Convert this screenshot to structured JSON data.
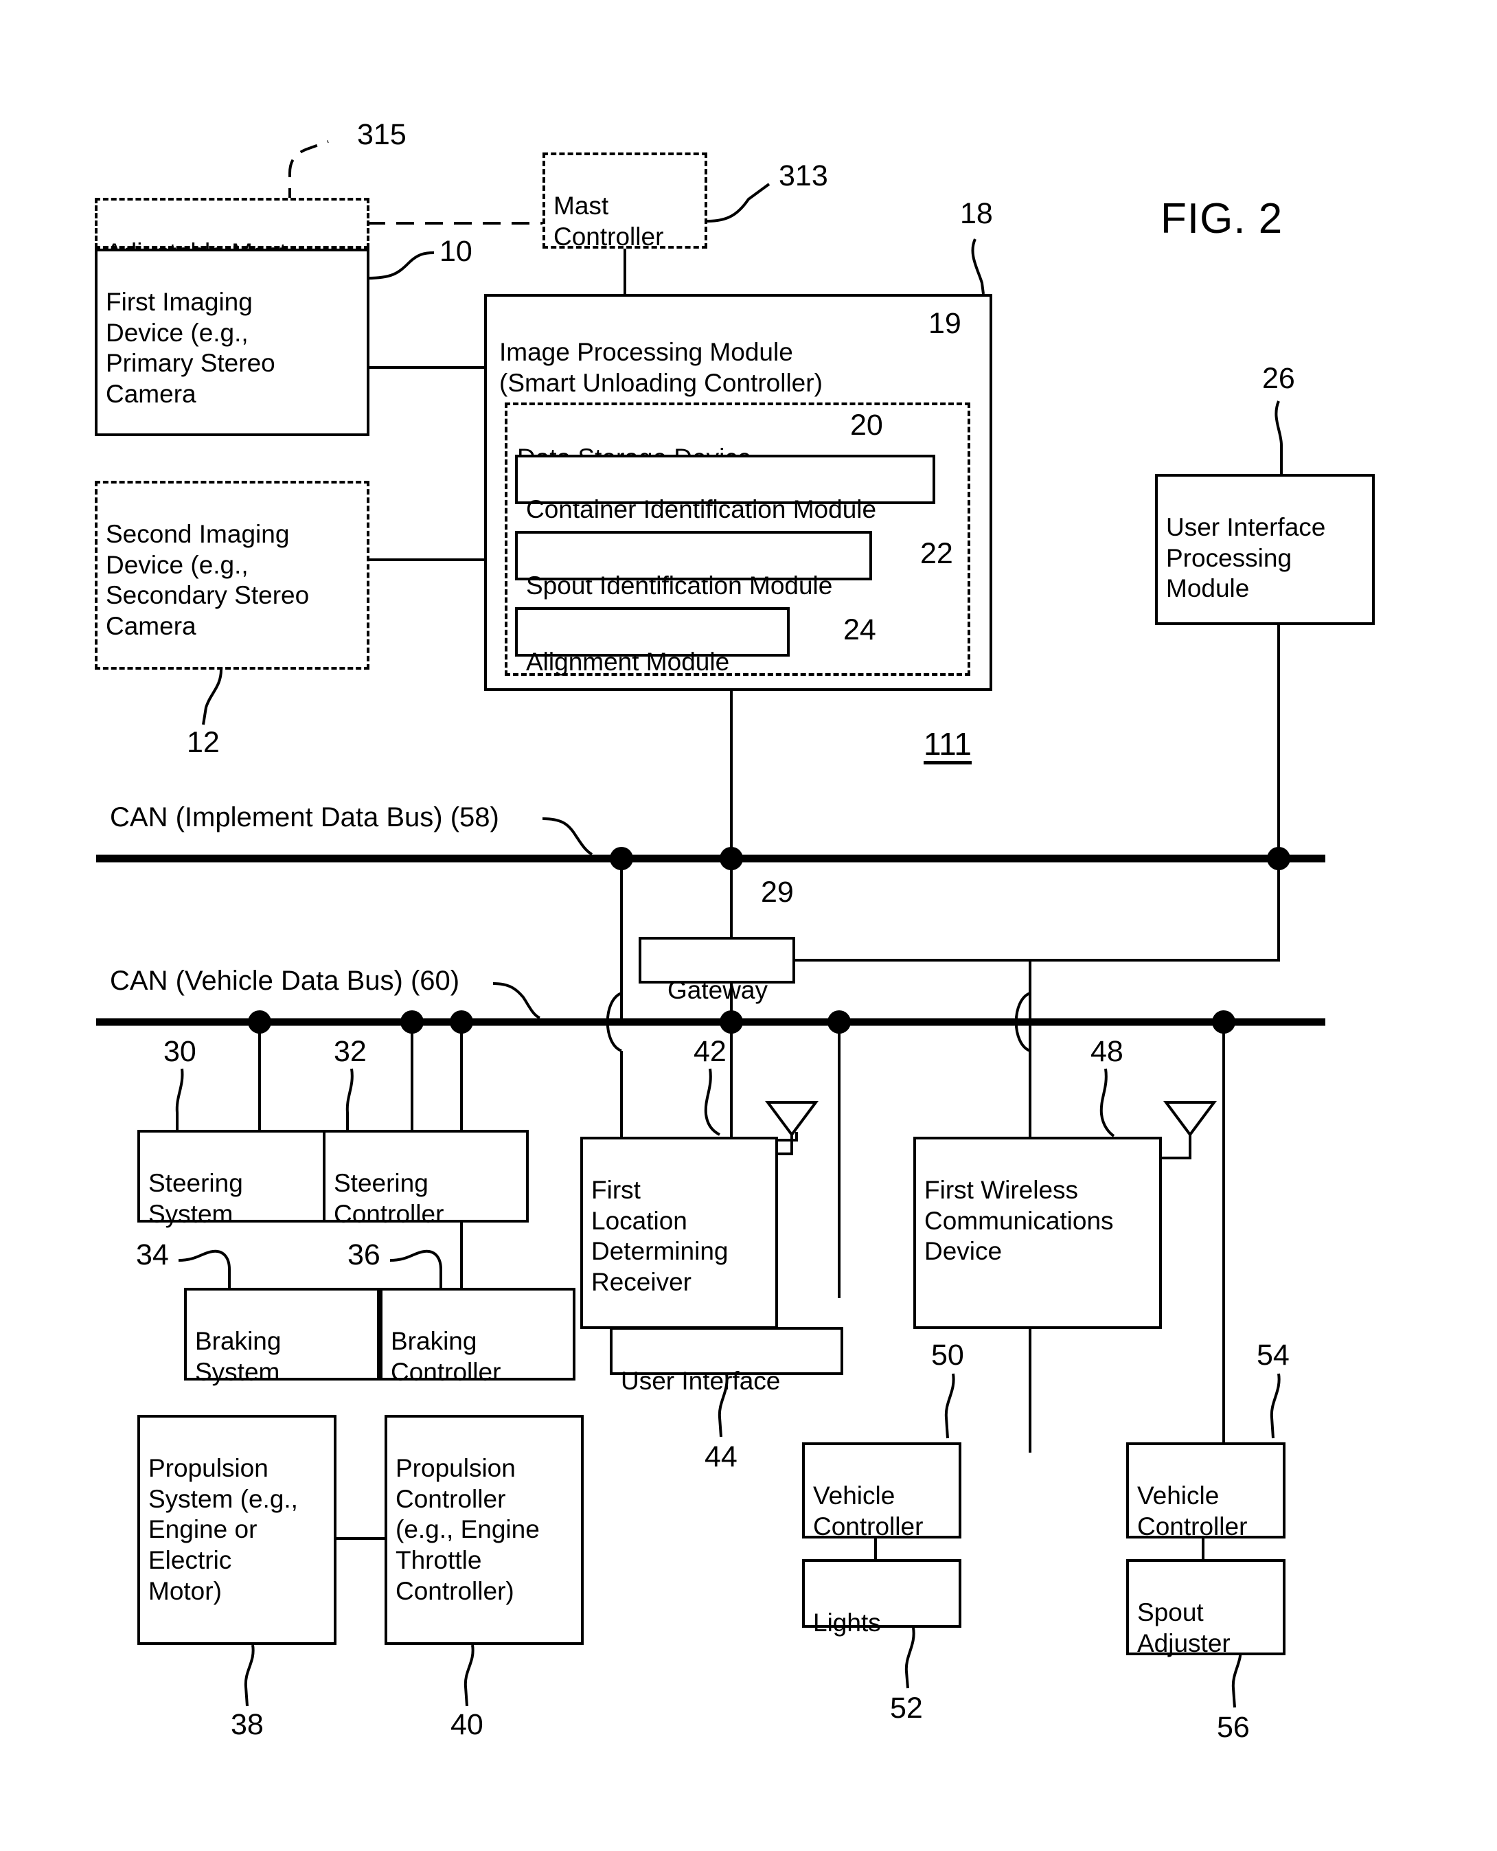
{
  "figure": {
    "label": "FIG. 2",
    "system_ref": "111"
  },
  "blocks": {
    "adjustable_mast": {
      "text": "Adjustable Mast",
      "ref": "315"
    },
    "first_imaging_device": {
      "text": "First Imaging\nDevice (e.g.,\nPrimary Stereo\nCamera",
      "ref": "10"
    },
    "second_imaging_device": {
      "text": "Second Imaging\nDevice (e.g.,\nSecondary Stereo\nCamera",
      "ref": "12"
    },
    "mast_controller": {
      "text": "Mast\nController",
      "ref": "313"
    },
    "image_processing_module": {
      "text": "Image Processing Module\n(Smart Unloading Controller)",
      "ref": "18",
      "inner_ref": "19"
    },
    "data_storage_device": {
      "text": "Data Storage Device",
      "ref": "20"
    },
    "container_identification_module": {
      "text": "Container Identification Module",
      "ref": ""
    },
    "spout_identification_module": {
      "text": "Spout Identification Module",
      "ref": "22"
    },
    "alignment_module": {
      "text": "Alignment Module",
      "ref": "24"
    },
    "user_interface_processing_module": {
      "text": "User Interface\nProcessing\nModule",
      "ref": "26"
    },
    "gateway": {
      "text": "Gateway",
      "ref": "29"
    },
    "steering_system": {
      "text": "Steering\nSystem",
      "ref": "30"
    },
    "steering_controller": {
      "text": "Steering\nController",
      "ref": "32"
    },
    "braking_system": {
      "text": "Braking\nSystem",
      "ref": "34"
    },
    "braking_controller": {
      "text": "Braking\nController",
      "ref": "36"
    },
    "propulsion_system": {
      "text": "Propulsion\nSystem (e.g.,\nEngine or\nElectric\nMotor)",
      "ref": "38"
    },
    "propulsion_controller": {
      "text": "Propulsion\nController\n(e.g., Engine\nThrottle\nController)",
      "ref": "40"
    },
    "first_location_determining_receiver": {
      "text": "First\nLocation\nDetermining\nReceiver",
      "ref": "42"
    },
    "user_interface": {
      "text": "User Interface",
      "ref": "44"
    },
    "first_wireless_communications_device": {
      "text": "First Wireless\nCommunications\nDevice",
      "ref": "48"
    },
    "vehicle_controller_lights": {
      "text": "Vehicle\nController",
      "ref": "50"
    },
    "lights": {
      "text": "Lights",
      "ref": "52"
    },
    "vehicle_controller_spout": {
      "text": "Vehicle\nController",
      "ref": "54"
    },
    "spout_adjuster": {
      "text": "Spout\nAdjuster",
      "ref": "56"
    }
  },
  "buses": {
    "implement_bus_label": "CAN (Implement Data Bus) (58)",
    "vehicle_bus_label": "CAN (Vehicle Data Bus) (60)"
  },
  "colors": {
    "ink": "#000000",
    "paper": "#ffffff"
  }
}
